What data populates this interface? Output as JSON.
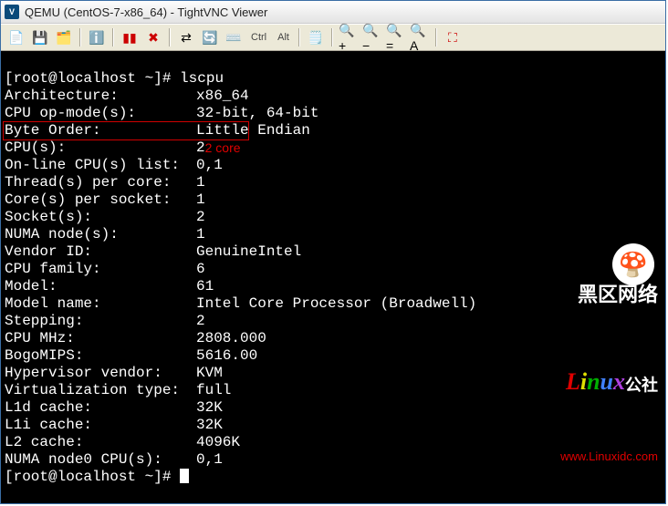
{
  "window": {
    "title": "QEMU (CentOS-7-x86_64) - TightVNC Viewer"
  },
  "toolbar": {
    "ctrl": "Ctrl",
    "alt": "Alt"
  },
  "prompt": "[root@localhost ~]#",
  "command": "lscpu",
  "lscpu": [
    {
      "key": "Architecture:",
      "val": "x86_64"
    },
    {
      "key": "CPU op-mode(s):",
      "val": "32-bit, 64-bit"
    },
    {
      "key": "Byte Order:",
      "val": "Little Endian"
    },
    {
      "key": "CPU(s):",
      "val": "2"
    },
    {
      "key": "On-line CPU(s) list:",
      "val": "0,1"
    },
    {
      "key": "Thread(s) per core:",
      "val": "1"
    },
    {
      "key": "Core(s) per socket:",
      "val": "1"
    },
    {
      "key": "Socket(s):",
      "val": "2"
    },
    {
      "key": "NUMA node(s):",
      "val": "1"
    },
    {
      "key": "Vendor ID:",
      "val": "GenuineIntel"
    },
    {
      "key": "CPU family:",
      "val": "6"
    },
    {
      "key": "Model:",
      "val": "61"
    },
    {
      "key": "Model name:",
      "val": "Intel Core Processor (Broadwell)"
    },
    {
      "key": "Stepping:",
      "val": "2"
    },
    {
      "key": "CPU MHz:",
      "val": "2808.000"
    },
    {
      "key": "BogoMIPS:",
      "val": "5616.00"
    },
    {
      "key": "Hypervisor vendor:",
      "val": "KVM"
    },
    {
      "key": "Virtualization type:",
      "val": "full"
    },
    {
      "key": "L1d cache:",
      "val": "32K"
    },
    {
      "key": "L1i cache:",
      "val": "32K"
    },
    {
      "key": "L2 cache:",
      "val": "4096K"
    },
    {
      "key": "NUMA node0 CPU(s):",
      "val": "0,1"
    }
  ],
  "annotation": "2 core",
  "watermark": {
    "brand": "黑区网络",
    "suffix": "公社",
    "url": "www.Linuxidc.com"
  }
}
